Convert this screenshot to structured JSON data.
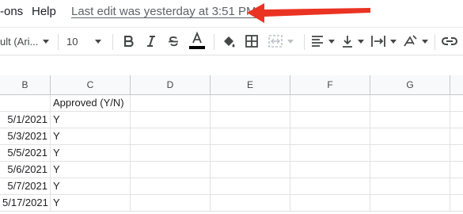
{
  "menubar": {
    "items": [
      "-ons",
      "Help"
    ],
    "last_edit": "Last edit was yesterday at 3:51 PM"
  },
  "toolbar": {
    "font_name": "ult (Ari...",
    "font_size": "10",
    "icons": [
      "bold-icon",
      "italic-icon",
      "strikethrough-icon",
      "text-color-icon",
      "fill-color-icon",
      "borders-icon",
      "merge-cells-icon",
      "horizontal-align-icon",
      "vertical-align-icon",
      "text-wrap-icon",
      "text-rotation-icon",
      "link-icon"
    ],
    "accent_color": "#000000"
  },
  "columns": [
    "B",
    "C",
    "D",
    "E",
    "F",
    "G"
  ],
  "rows": [
    {
      "b": "",
      "c": "Approved (Y/N)"
    },
    {
      "b": "5/1/2021",
      "c": "Y"
    },
    {
      "b": "5/3/2021",
      "c": "Y"
    },
    {
      "b": "5/5/2021",
      "c": "Y"
    },
    {
      "b": "5/6/2021",
      "c": "Y"
    },
    {
      "b": "5/7/2021",
      "c": "Y"
    },
    {
      "b": "5/17/2021",
      "c": "Y"
    }
  ],
  "annotation_color": "#ea3323"
}
